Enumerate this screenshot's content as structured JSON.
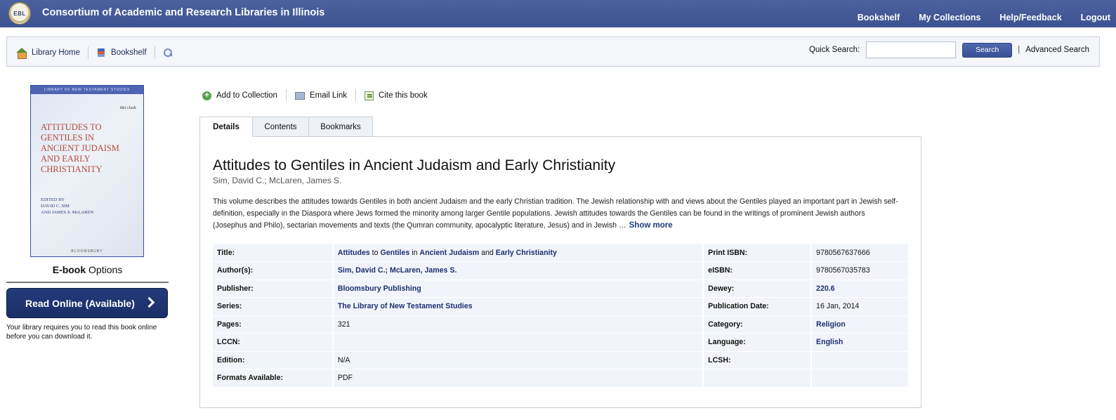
{
  "header": {
    "logo_text": "EBL",
    "site_title": "Consortium of Academic and Research Libraries in Illinois",
    "nav": [
      "Bookshelf",
      "My Collections",
      "Help/Feedback",
      "Logout"
    ]
  },
  "toolbar": {
    "library_home": "Library Home",
    "bookshelf": "Bookshelf",
    "quick_search_label": "Quick Search:",
    "quick_search_value": "",
    "search_button": "Search",
    "separator": "|",
    "advanced_search": "Advanced Search"
  },
  "cover": {
    "series_band": "LIBRARY OF NEW TESTAMENT STUDIES",
    "publisher_mark": "t&t clark",
    "title_lines": [
      "ATTITUDES TO",
      "GENTILES IN",
      "ANCIENT JUDAISM",
      "AND EARLY",
      "CHRISTIANITY"
    ],
    "editor_lines": [
      "EDITED BY",
      "DAVID C. SIM",
      "AND JAMES S. McLAREN"
    ],
    "imprint": "BLOOMSBURY"
  },
  "left": {
    "ebook_bold": "E-book",
    "ebook_rest": " Options",
    "read_online": "Read Online (Available)",
    "note": "Your library requires you to read this book online before you can download it."
  },
  "actions": {
    "add_to_collection": "Add to Collection",
    "email_link": "Email Link",
    "cite": "Cite this book"
  },
  "tabs": [
    "Details",
    "Contents",
    "Bookmarks"
  ],
  "book": {
    "title": "Attitudes to Gentiles in Ancient Judaism and Early Christianity",
    "authors": "Sim, David C.; McLaren, James S.",
    "description": "This volume describes the attitudes towards Gentiles in both ancient Judaism and the early Christian tradition. The Jewish relationship with and views about the Gentiles played an important part in Jewish self-definition, especially in the Diaspora where Jews formed the minority among larger Gentile populations. Jewish attitudes towards the Gentiles can be found in the writings of prominent Jewish authors (Josephus and Philo), sectarian movements and texts (the Qumran community, apocalyptic literature, Jesus) and in Jewish …",
    "show_more": "Show more"
  },
  "details": {
    "rows": [
      {
        "l1": "Title:",
        "l2": "Print ISBN:",
        "v2": "9780567637666"
      },
      {
        "l1": "Author(s):",
        "v1a": "Sim, David C.",
        "v1sep": "; ",
        "v1b": "McLaren, James S.",
        "l2": "eISBN:",
        "v2": "9780567035783"
      },
      {
        "l1": "Publisher:",
        "v1": "Bloomsbury Publishing",
        "l2": "Dewey:",
        "v2": "220.6"
      },
      {
        "l1": "Series:",
        "v1": "The Library of New Testament Studies",
        "l2": "Publication Date:",
        "v2": "16 Jan, 2014"
      },
      {
        "l1": "Pages:",
        "v1": "321",
        "l2": "Category:",
        "v2": "Religion"
      },
      {
        "l1": "LCCN:",
        "v1": "",
        "l2": "Language:",
        "v2": "English"
      },
      {
        "l1": "Edition:",
        "v1": "N/A",
        "l2": "LCSH:",
        "v2": ""
      },
      {
        "l1": "Formats Available:",
        "v1": "PDF",
        "l2": "",
        "v2": ""
      }
    ],
    "title_words": [
      "Attitudes",
      " to ",
      "Gentiles",
      " in ",
      "Ancient Judaism",
      " and ",
      "Early Christianity"
    ]
  }
}
